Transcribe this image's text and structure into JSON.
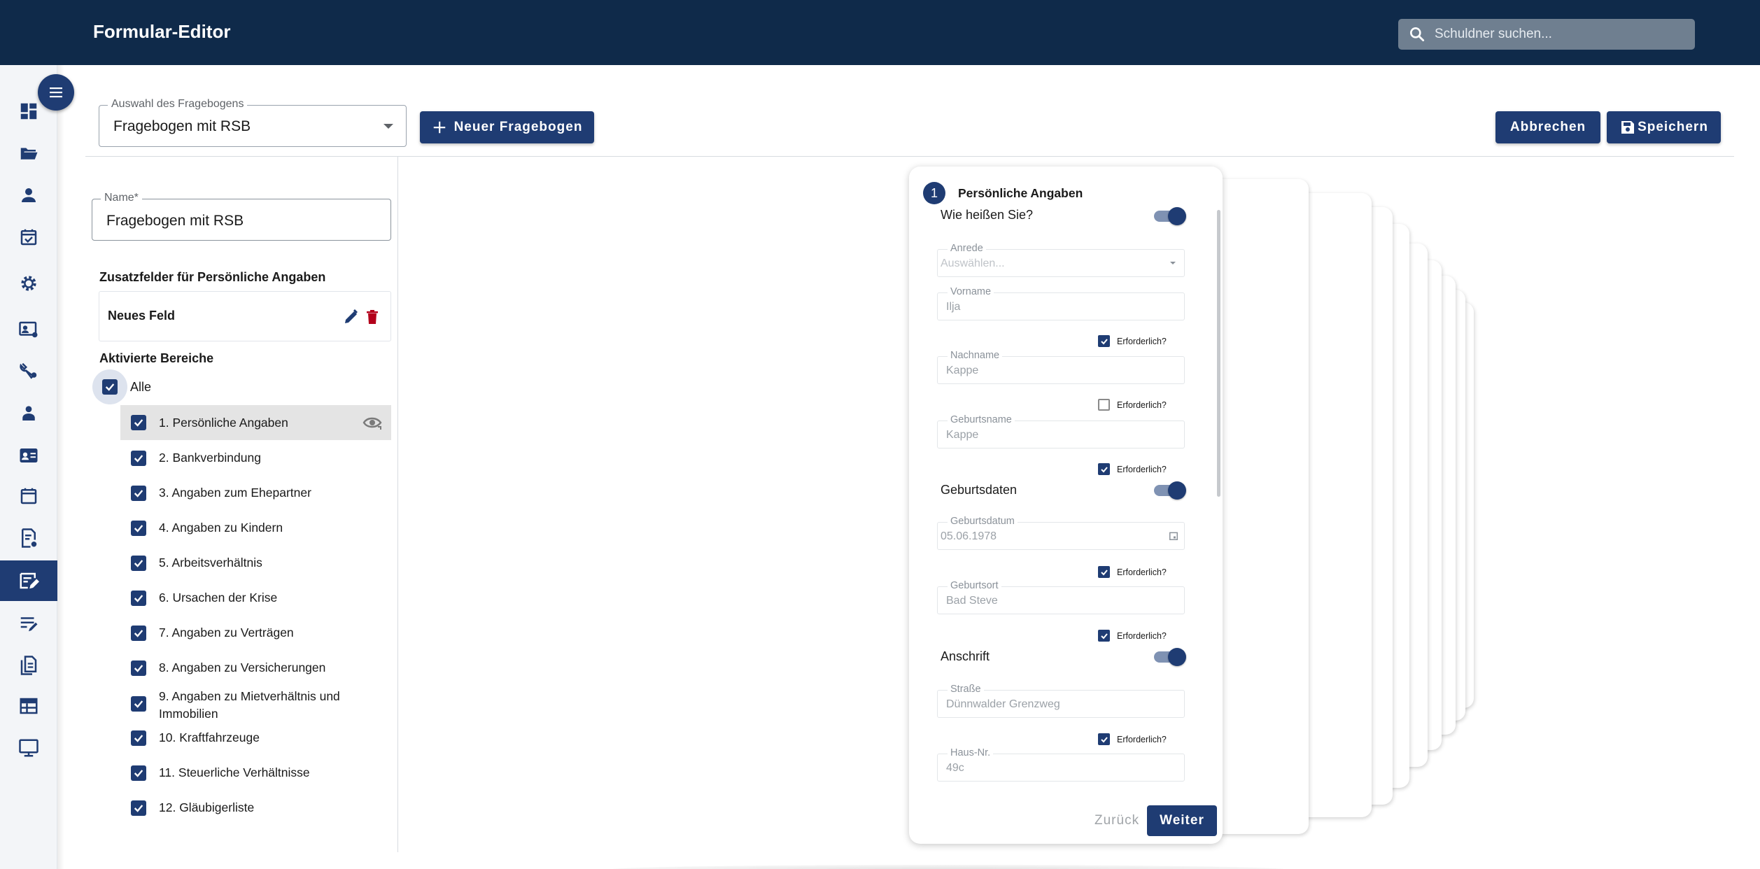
{
  "header": {
    "title": "Formular-Editor",
    "search_placeholder": "Schuldner suchen..."
  },
  "sidebar": {
    "items": [
      {
        "icon": "dashboard-icon"
      },
      {
        "icon": "folder-open-icon"
      },
      {
        "icon": "person-icon"
      },
      {
        "icon": "event-available-icon"
      },
      {
        "icon": "gear-icon"
      },
      {
        "icon": "contact-settings-icon"
      },
      {
        "icon": "tools-settings-icon"
      },
      {
        "icon": "supervisor-icon"
      },
      {
        "icon": "contact-card-icon"
      },
      {
        "icon": "calendar-icon"
      },
      {
        "icon": "document-settings-icon"
      },
      {
        "icon": "form-edit-icon",
        "active": true
      },
      {
        "icon": "notes-edit-icon"
      },
      {
        "icon": "file-copy-icon"
      },
      {
        "icon": "table-icon"
      },
      {
        "icon": "monitor-icon"
      }
    ],
    "accent": "#1f3c73"
  },
  "toolbar": {
    "questionnaire_select_label": "Auswahl des Fragebogens",
    "questionnaire_select_value": "Fragebogen mit RSB",
    "new_button": "Neuer Fragebogen",
    "cancel_button": "Abbrechen",
    "save_button": "Speichern"
  },
  "editor": {
    "name_label": "Name*",
    "name_value": "Fragebogen mit RSB",
    "extra_fields_title": "Zusatzfelder für Persönliche Angaben",
    "extra_field_label": "Neues Feld",
    "active_areas_title": "Aktivierte Bereiche",
    "all_label": "Alle",
    "areas": [
      {
        "label": "1. Persönliche Angaben",
        "checked": true,
        "selected": true
      },
      {
        "label": "2. Bankverbindung",
        "checked": true
      },
      {
        "label": "3. Angaben zum Ehepartner",
        "checked": true
      },
      {
        "label": "4. Angaben zu Kindern",
        "checked": true
      },
      {
        "label": "5. Arbeitsverhältnis",
        "checked": true
      },
      {
        "label": "6. Ursachen der Krise",
        "checked": true
      },
      {
        "label": "7. Angaben zu Verträgen",
        "checked": true
      },
      {
        "label": "8. Angaben zu Versicherungen",
        "checked": true
      },
      {
        "label": "9. Angaben zu Mietverhältnis und Immobilien",
        "checked": true
      },
      {
        "label": "10. Kraftfahrzeuge",
        "checked": true
      },
      {
        "label": "11. Steuerliche Verhältnisse",
        "checked": true
      },
      {
        "label": "12. Gläubigerliste",
        "checked": true
      }
    ]
  },
  "preview": {
    "step_number": "1",
    "step_title": "Persönliche Angaben",
    "groups": [
      {
        "label": "Wie heißen Sie?",
        "toggle_on": true
      },
      {
        "label": "Geburtsdaten",
        "toggle_on": true
      },
      {
        "label": "Anschrift",
        "toggle_on": true
      }
    ],
    "fields": {
      "anrede": {
        "label": "Anrede",
        "placeholder": "Auswählen..."
      },
      "vorname": {
        "label": "Vorname",
        "value": "Ilja",
        "required": true
      },
      "nachname": {
        "label": "Nachname",
        "value": "Kappe",
        "required": false
      },
      "geburtsname": {
        "label": "Geburtsname",
        "value": "Kappe",
        "required": true
      },
      "geburtsdatum": {
        "label": "Geburtsdatum",
        "value": "05.06.1978",
        "required": true
      },
      "geburtsort": {
        "label": "Geburtsort",
        "value": "Bad Steve",
        "required": true
      },
      "strasse": {
        "label": "Straße",
        "value": "Dünnwalder Grenzweg",
        "required": true
      },
      "hausnr": {
        "label": "Haus-Nr.",
        "value": "49c"
      }
    },
    "required_label": "Erforderlich?",
    "back_button": "Zurück",
    "next_button": "Weiter"
  }
}
